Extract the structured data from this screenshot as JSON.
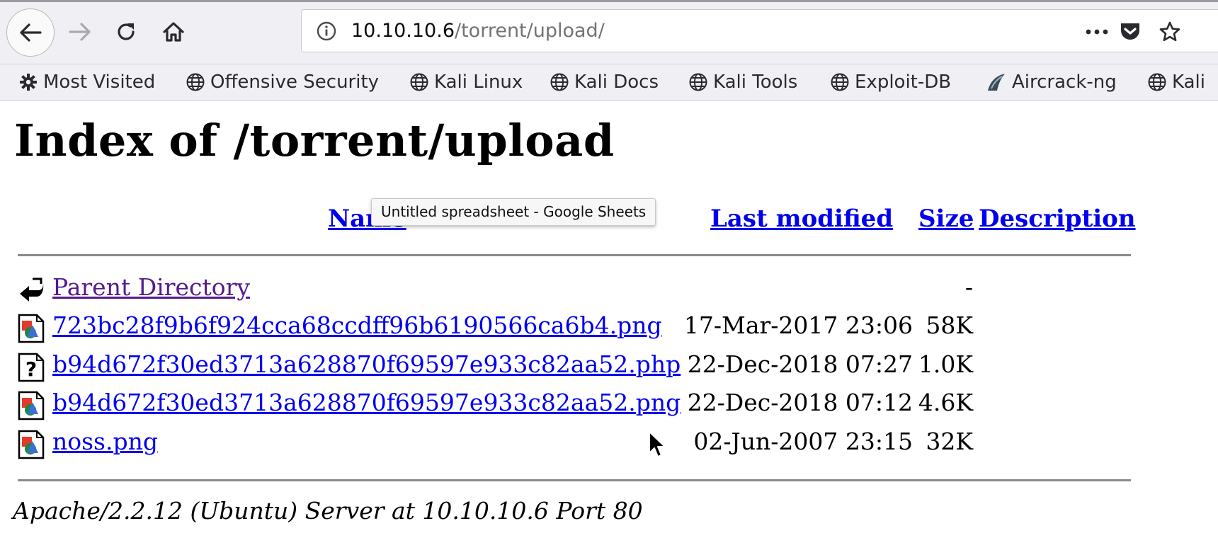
{
  "browser": {
    "url_host": "10.10.10.6",
    "url_path": "/torrent/upload/",
    "icons": {
      "back": "back-arrow-icon",
      "forward": "forward-arrow-icon",
      "reload": "reload-icon",
      "home": "home-icon",
      "info": "info-icon",
      "more": "ellipsis-icon",
      "pocket": "pocket-icon",
      "star": "star-icon"
    }
  },
  "bookmarks": [
    {
      "label": "Most Visited",
      "icon": "gear-icon"
    },
    {
      "label": "Offensive Security",
      "icon": "globe-icon"
    },
    {
      "label": "Kali Linux",
      "icon": "globe-icon"
    },
    {
      "label": "Kali Docs",
      "icon": "globe-icon"
    },
    {
      "label": "Kali Tools",
      "icon": "globe-icon"
    },
    {
      "label": "Exploit-DB",
      "icon": "globe-icon"
    },
    {
      "label": "Aircrack-ng",
      "icon": "aircrack-icon"
    },
    {
      "label": "Kali",
      "icon": "globe-icon"
    }
  ],
  "page": {
    "title": "Index of /torrent/upload",
    "columns": {
      "name": "Name",
      "last_modified": "Last modified",
      "size": "Size",
      "description": "Description"
    },
    "rows": [
      {
        "name": "Parent Directory",
        "date": "",
        "size": "-",
        "icon": "back-folder-icon",
        "visited": true
      },
      {
        "name": "723bc28f9b6f924cca68ccdff96b6190566ca6b4.png",
        "date": "17-Mar-2017 23:06",
        "size": "58K",
        "icon": "image-file-icon"
      },
      {
        "name": "b94d672f30ed3713a628870f69597e933c82aa52.php",
        "date": "22-Dec-2018 07:27",
        "size": "1.0K",
        "icon": "unknown-file-icon"
      },
      {
        "name": "b94d672f30ed3713a628870f69597e933c82aa52.png",
        "date": "22-Dec-2018 07:12",
        "size": "4.6K",
        "icon": "image-file-icon"
      },
      {
        "name": "noss.png",
        "date": "02-Jun-2007 23:15",
        "size": "32K",
        "icon": "image-file-icon"
      }
    ],
    "footer": "Apache/2.2.12 (Ubuntu) Server at 10.10.10.6 Port 80"
  },
  "tooltip": "Untitled spreadsheet - Google Sheets",
  "colors": {
    "link": "#0000ee",
    "visited_link": "#551a8b",
    "chrome_bg": "#f0f0f4",
    "rule": "#8a8a8a"
  }
}
